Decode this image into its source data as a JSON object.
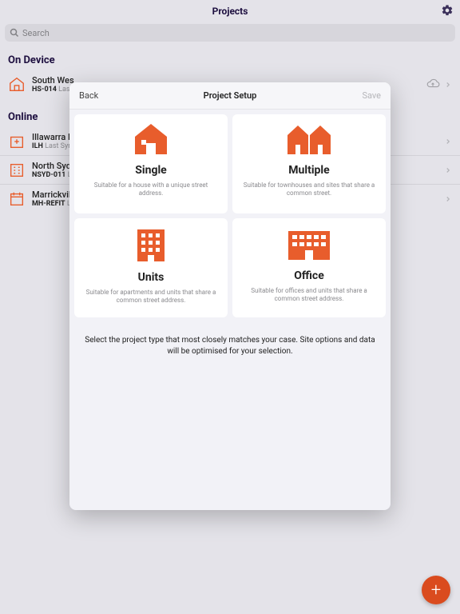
{
  "header": {
    "title": "Projects"
  },
  "search": {
    "placeholder": "Search"
  },
  "sections": {
    "on_device": "On Device",
    "online": "Online"
  },
  "rows": {
    "sw": {
      "title": "South Wes",
      "code": "HS-014",
      "sub": "Last S"
    },
    "il": {
      "title": "Illawarra H",
      "code": "ILH",
      "sub": "Last Sync"
    },
    "ns": {
      "title": "North Sydn",
      "code": "NSYD-011",
      "sub": "La"
    },
    "mv": {
      "title": "Marrickville",
      "code": "MH-REFIT",
      "sub": "La"
    }
  },
  "fab": {
    "label": "+"
  },
  "modal": {
    "back": "Back",
    "title": "Project Setup",
    "save": "Save",
    "footer": "Select the project type that most closely matches your case. Site options and data will be optimised for your selection.",
    "cards": {
      "single": {
        "title": "Single",
        "desc": "Suitable for a house with a unique street address."
      },
      "multiple": {
        "title": "Multiple",
        "desc": "Suitable for townhouses and sites that share a common street."
      },
      "units": {
        "title": "Units",
        "desc": "Suitable for apartments and units that share a common street address."
      },
      "office": {
        "title": "Office",
        "desc": "Suitable for offices and units that share a common street address."
      }
    }
  }
}
